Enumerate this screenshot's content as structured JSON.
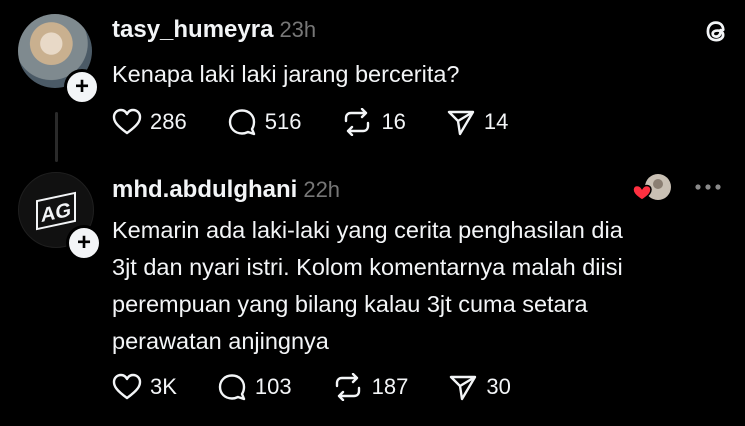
{
  "post1": {
    "username": "tasy_humeyra",
    "time": "23h",
    "text": "Kenapa laki laki jarang bercerita?",
    "likes": "286",
    "replies": "516",
    "reposts": "16",
    "shares": "14"
  },
  "post2": {
    "username": "mhd.abdulghani",
    "time": "22h",
    "text_lines": [
      "Kemarin ada laki-laki yang cerita penghasilan dia",
      "3jt dan nyari istri. Kolom komentarnya malah diisi",
      "perempuan yang bilang kalau 3jt cuma setara",
      "perawatan anjingnya"
    ],
    "likes": "3K",
    "replies": "103",
    "reposts": "187",
    "shares": "30",
    "avatar_logo": "AG"
  },
  "icons": {
    "like": "heart-icon",
    "reply": "comment-icon",
    "repost": "repost-icon",
    "share": "send-icon",
    "app": "threads-logo-icon",
    "more": "more-icon"
  },
  "colors": {
    "background": "#000000",
    "text": "#f3f5f7",
    "muted": "#777777",
    "heart_accent": "#ff3040"
  }
}
